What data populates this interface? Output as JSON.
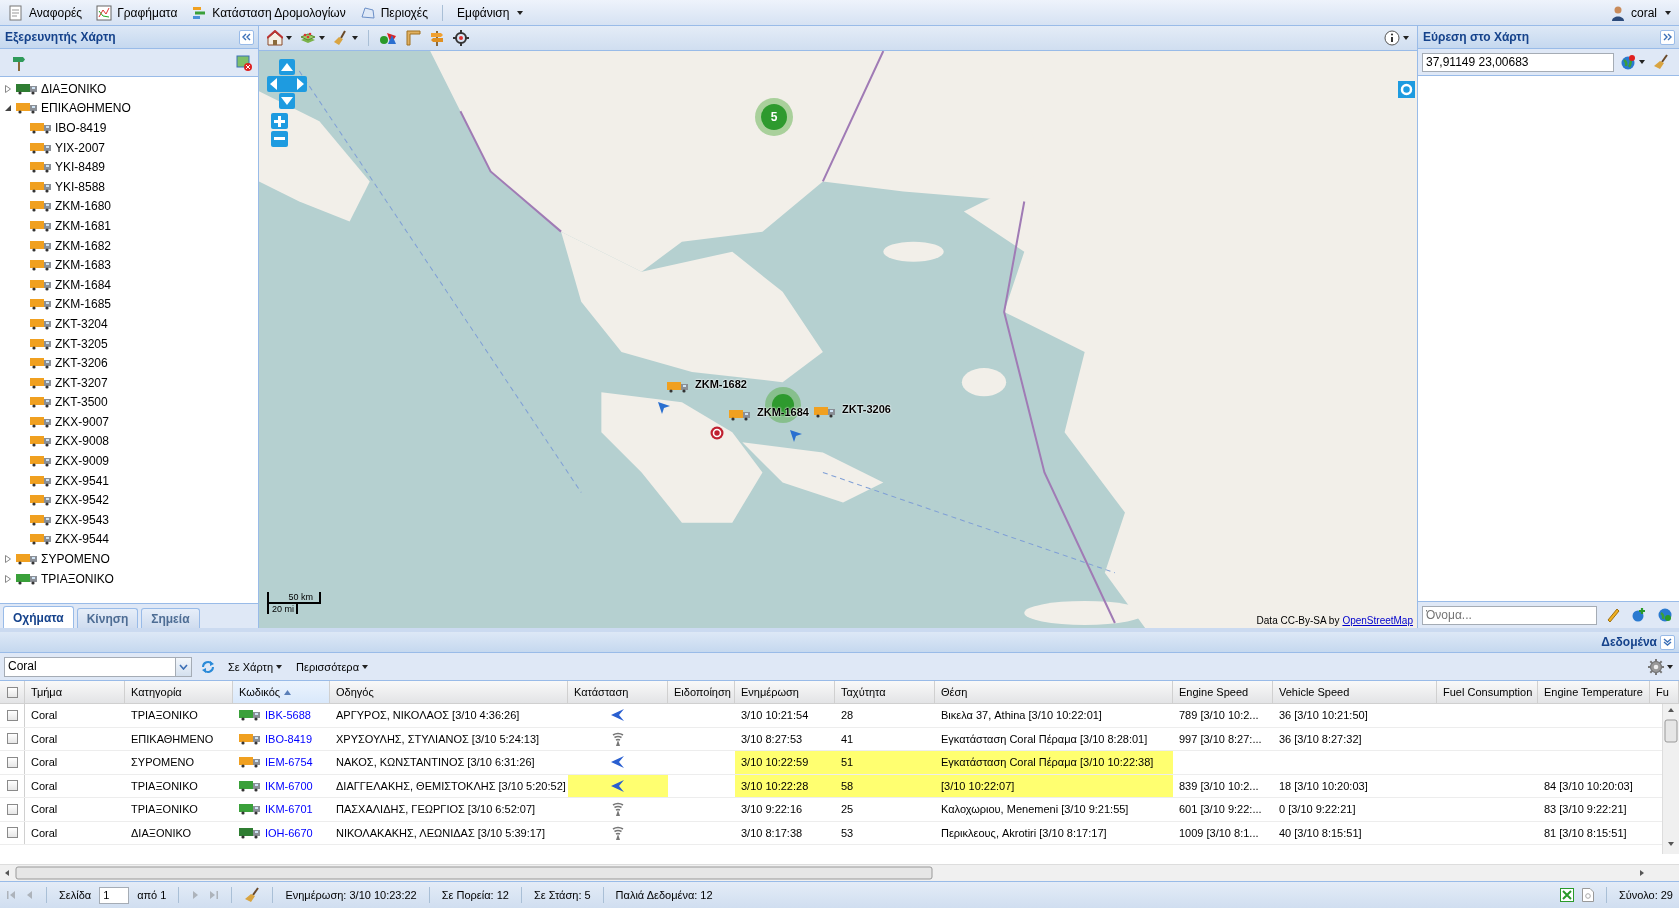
{
  "menu": {
    "items": [
      {
        "label": "Αναφορές"
      },
      {
        "label": "Γραφήματα"
      },
      {
        "label": "Κατάσταση Δρομολογίων"
      },
      {
        "label": "Περιοχές"
      },
      {
        "label": "Εμφάνιση",
        "dropdown": true
      }
    ],
    "user": "coral"
  },
  "left_panel": {
    "title": "Εξερευνητής Χάρτη",
    "tree": [
      {
        "label": "ΔΙΑΞΟΝΙΚΟ",
        "color": "#2f7d32",
        "expanded": false
      },
      {
        "label": "ΕΠΙΚΑΘΗΜΕΝΟ",
        "color": "#f0a020",
        "expanded": true,
        "children": [
          {
            "label": "IBO-8419",
            "color": "#f0a020"
          },
          {
            "label": "YIX-2007",
            "color": "#f0a020"
          },
          {
            "label": "YKI-8489",
            "color": "#f0a020"
          },
          {
            "label": "YKI-8588",
            "color": "#f0a020"
          },
          {
            "label": "ZKM-1680",
            "color": "#f0a020"
          },
          {
            "label": "ZKM-1681",
            "color": "#f0a020"
          },
          {
            "label": "ZKM-1682",
            "color": "#f0a020"
          },
          {
            "label": "ZKM-1683",
            "color": "#f0a020"
          },
          {
            "label": "ZKM-1684",
            "color": "#f0a020"
          },
          {
            "label": "ZKM-1685",
            "color": "#f0a020"
          },
          {
            "label": "ZKT-3204",
            "color": "#f0a020"
          },
          {
            "label": "ZKT-3205",
            "color": "#f0a020"
          },
          {
            "label": "ZKT-3206",
            "color": "#f0a020"
          },
          {
            "label": "ZKT-3207",
            "color": "#f0a020"
          },
          {
            "label": "ZKT-3500",
            "color": "#f0a020"
          },
          {
            "label": "ZKX-9007",
            "color": "#f0a020"
          },
          {
            "label": "ZKX-9008",
            "color": "#f0a020"
          },
          {
            "label": "ZKX-9009",
            "color": "#f0a020"
          },
          {
            "label": "ZKX-9541",
            "color": "#f0a020"
          },
          {
            "label": "ZKX-9542",
            "color": "#f0a020"
          },
          {
            "label": "ZKX-9543",
            "color": "#f0a020"
          },
          {
            "label": "ZKX-9544",
            "color": "#f0a020"
          }
        ]
      },
      {
        "label": "ΣΥΡΟΜΕΝΟ",
        "color": "#f0a020",
        "expanded": false
      },
      {
        "label": "ΤΡΙΑΞΟΝΙΚΟ",
        "color": "#3aa03a",
        "expanded": false
      }
    ],
    "tabs": [
      {
        "label": "Οχήματα",
        "selected": true
      },
      {
        "label": "Κίνηση",
        "selected": false
      },
      {
        "label": "Σημεία",
        "selected": false
      }
    ]
  },
  "map": {
    "clusters": [
      {
        "count": "5"
      }
    ],
    "vehicle_markers": [
      {
        "label": "ZKM-1682"
      },
      {
        "label": "ZKM-1684"
      },
      {
        "label": "ZKT-3206"
      }
    ],
    "scale": {
      "metric": "50 km",
      "imperial": "20 mi"
    },
    "attribution": {
      "text": "Data CC-By-SA by",
      "link": "OpenStreetMap"
    }
  },
  "search_panel": {
    "title": "Εύρεση στο Χάρτη",
    "query": "37,91149 23,00683",
    "name_placeholder": "Όνομα..."
  },
  "data_panel": {
    "title": "Δεδομένα",
    "company": "Coral",
    "buttons": [
      {
        "label": "Σε Χάρτη"
      },
      {
        "label": "Περισσότερα"
      }
    ],
    "select_all_checked": false,
    "columns": [
      {
        "label": "Τμήμα",
        "sorted": false
      },
      {
        "label": "Κατηγορία",
        "sorted": false
      },
      {
        "label": "Κωδικός",
        "sorted": true
      },
      {
        "label": "Οδηγός",
        "sorted": false
      },
      {
        "label": "Κατάσταση",
        "sorted": false
      },
      {
        "label": "Ειδοποίηση",
        "sorted": false
      },
      {
        "label": "Ενημέρωση",
        "sorted": false
      },
      {
        "label": "Ταχύτητα",
        "sorted": false
      },
      {
        "label": "Θέση",
        "sorted": false
      },
      {
        "label": "Engine Speed",
        "sorted": false
      },
      {
        "label": "Vehicle Speed",
        "sorted": false
      },
      {
        "label": "Fuel Consumption",
        "sorted": false
      },
      {
        "label": "Engine Temperature",
        "sorted": false
      },
      {
        "label": "Fu",
        "sorted": false
      }
    ],
    "rows": [
      {
        "checked": false,
        "alert": false,
        "status_alert": false,
        "status": {
          "kind": "heading"
        },
        "color": "#3aa03a",
        "department": "Coral",
        "category": "ΤΡΙΑΞΟΝΙΚΟ",
        "code": "IBK-5688",
        "driver": "ΑΡΓΥΡΟΣ, ΝΙΚΟΛΑΟΣ [3/10 4:36:26]",
        "updated": "3/10 10:21:54",
        "speed": "28",
        "position": "Βικελα 37, Athina [3/10 10:22:01]",
        "engine_speed": "789 [3/10 10:2...",
        "vehicle_speed": "36 [3/10 10:21:50]"
      },
      {
        "checked": false,
        "alert": false,
        "status_alert": false,
        "status": {
          "kind": "signal"
        },
        "color": "#f0a020",
        "department": "Coral",
        "category": "ΕΠΙΚΑΘΗΜΕΝΟ",
        "code": "IBO-8419",
        "driver": "ΧΡΥΣΟΥΛΗΣ, ΣΤΥΛΙΑΝΟΣ [3/10 5:24:13]",
        "updated": "3/10 8:27:53",
        "speed": "41",
        "position": "Εγκατάσταση Coral Πέραμα [3/10 8:28:01]",
        "engine_speed": "997 [3/10 8:27:...",
        "vehicle_speed": "36 [3/10 8:27:32]"
      },
      {
        "checked": false,
        "alert": true,
        "status_alert": false,
        "status": {
          "kind": "heading"
        },
        "color": "#f0a020",
        "department": "Coral",
        "category": "ΣΥΡΟΜΕΝΟ",
        "code": "IEM-6754",
        "driver": "ΝΑΚΟΣ, ΚΩΝΣΤΑΝΤΙΝΟΣ [3/10 6:31:26]",
        "updated": "3/10 10:22:59",
        "speed": "51",
        "position": "Εγκατάσταση Coral Πέραμα [3/10 10:22:38]"
      },
      {
        "checked": false,
        "alert": true,
        "status_alert": true,
        "status": {
          "kind": "heading"
        },
        "color": "#3aa03a",
        "department": "Coral",
        "category": "ΤΡΙΑΞΟΝΙΚΟ",
        "code": "IKM-6700",
        "driver": "ΔΙΑΓΓΕΛΑΚΗΣ, ΘΕΜΙΣΤΟΚΛΗΣ [3/10 5:20:52]",
        "updated": "3/10 10:22:28",
        "speed": "58",
        "position": "[3/10 10:22:07]",
        "engine_speed": "839 [3/10 10:2...",
        "vehicle_speed": "18 [3/10 10:20:03]",
        "engine_temp": "84 [3/10 10:20:03]"
      },
      {
        "checked": false,
        "alert": false,
        "status_alert": false,
        "status": {
          "kind": "signal"
        },
        "color": "#3aa03a",
        "department": "Coral",
        "category": "ΤΡΙΑΞΟΝΙΚΟ",
        "code": "IKM-6701",
        "driver": "ΠΑΣΧΑΛΙΔΗΣ, ΓΕΩΡΓΙΟΣ [3/10 6:52:07]",
        "updated": "3/10 9:22:16",
        "speed": "25",
        "position": "Καλοχωριου, Menemeni [3/10 9:21:55]",
        "engine_speed": "601 [3/10 9:22:...",
        "vehicle_speed": "0 [3/10 9:22:21]",
        "engine_temp": "83 [3/10 9:22:21]"
      },
      {
        "checked": false,
        "alert": false,
        "status_alert": false,
        "status": {
          "kind": "signal"
        },
        "color": "#2f7d32",
        "department": "Coral",
        "category": "ΔΙΑΞΟΝΙΚΟ",
        "code": "IOH-6670",
        "driver": "ΝΙΚΟΛΑΚΑΚΗΣ, ΛΕΩΝΙΔΑΣ [3/10 5:39:17]",
        "updated": "3/10 8:17:38",
        "speed": "53",
        "position": "Περικλεους, Akrotiri [3/10 8:17:17]",
        "engine_speed": "1009 [3/10 8:1...",
        "vehicle_speed": "40 [3/10 8:15:51]",
        "engine_temp": "81 [3/10 8:15:51]"
      }
    ]
  },
  "paging": {
    "page_label": "Σελίδα",
    "page": "1",
    "of_label": "από 1",
    "updated": "Ενημέρωση: 3/10 10:23:22",
    "moving": "Σε Πορεία: 12",
    "stopped": "Σε Στάση: 5",
    "stale": "Παλιά Δεδομένα: 12",
    "total": "Σύνολο: 29"
  }
}
